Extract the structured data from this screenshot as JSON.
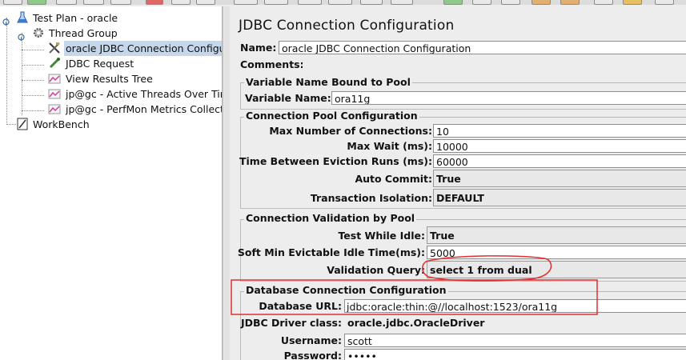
{
  "tree": {
    "items": [
      {
        "label": "Test Plan - oracle",
        "icon": "test-plan-icon"
      },
      {
        "label": "Thread Group",
        "icon": "thread-group-gear-icon"
      },
      {
        "label": "oracle JDBC Connection Configu",
        "icon": "config-tools-icon",
        "selected": true
      },
      {
        "label": "JDBC Request",
        "icon": "sampler-pipette-icon"
      },
      {
        "label": "View Results Tree",
        "icon": "listener-graph-icon"
      },
      {
        "label": "jp@gc - Active Threads Over Tir",
        "icon": "listener-graph-icon"
      },
      {
        "label": "jp@gc - PerfMon Metrics Collect",
        "icon": "listener-graph-icon"
      },
      {
        "label": "WorkBench",
        "icon": "workbench-icon"
      }
    ]
  },
  "panel": {
    "title": "JDBC Connection Configuration",
    "name_label": "Name:",
    "name_value": "oracle JDBC Connection Configuration",
    "comments_label": "Comments:",
    "pool_group": {
      "title": "Variable Name Bound to Pool",
      "variable_label": "Variable Name:",
      "variable_value": "ora11g"
    },
    "conn_pool": {
      "title": "Connection Pool Configuration",
      "max_conn_label": "Max Number of Connections:",
      "max_conn_value": "10",
      "max_wait_label": "Max Wait (ms):",
      "max_wait_value": "10000",
      "eviction_label": "Time Between Eviction Runs (ms):",
      "eviction_value": "60000",
      "autocommit_label": "Auto Commit:",
      "autocommit_value": "True",
      "isolation_label": "Transaction Isolation:",
      "isolation_value": "DEFAULT"
    },
    "validation": {
      "title": "Connection Validation by Pool",
      "test_idle_label": "Test While Idle:",
      "test_idle_value": "True",
      "soft_min_label": "Soft Min Evictable Idle Time(ms):",
      "soft_min_value": "5000",
      "query_label": "Validation Query:",
      "query_value": "select 1 from dual"
    },
    "db_conn": {
      "title": "Database Connection Configuration",
      "url_label": "Database URL:",
      "url_value": "jdbc:oracle:thin:@//localhost:1523/ora11g",
      "driver_label": "JDBC Driver class:",
      "driver_value": "oracle.jdbc.OracleDriver",
      "username_label": "Username:",
      "username_value": "scott",
      "password_label": "Password:",
      "password_value": "•••••"
    }
  },
  "annotations": {
    "highlight_color": "#e03030"
  }
}
